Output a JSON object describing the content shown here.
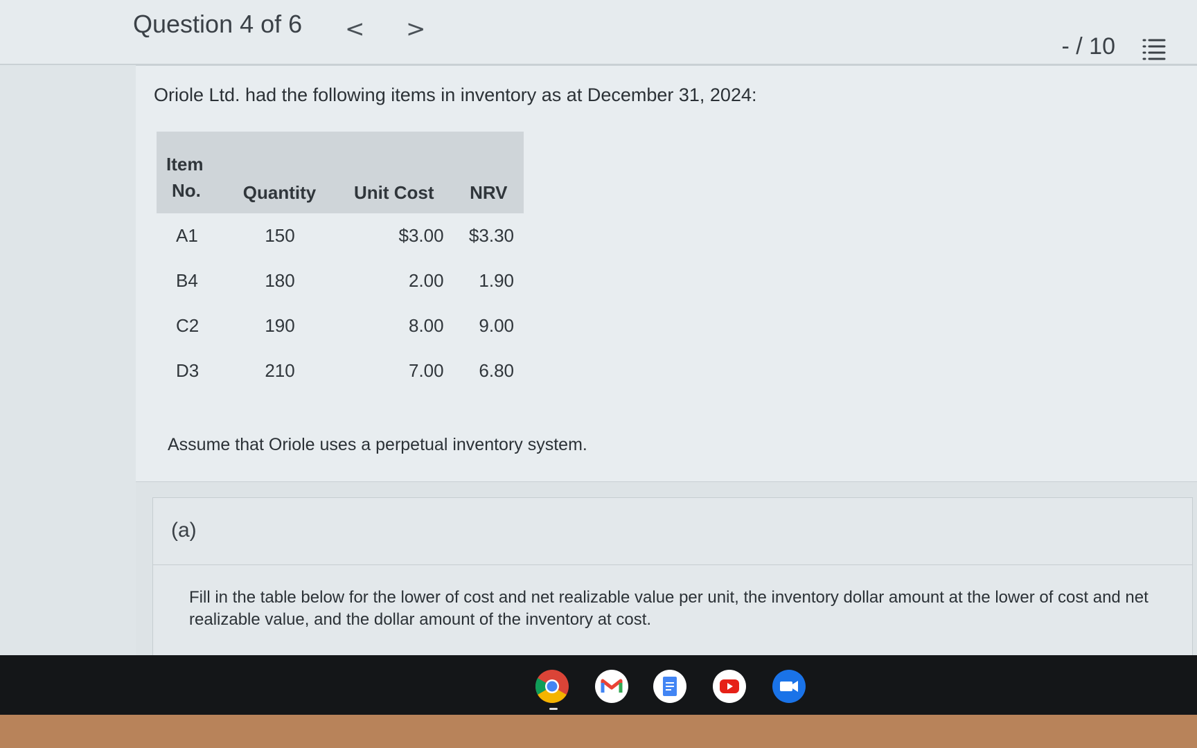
{
  "header": {
    "question_title": "Question 4 of 6",
    "prev_glyph": "<",
    "next_glyph": ">",
    "score": "- / 10"
  },
  "question": {
    "intro": "Oriole Ltd. had the following items in inventory as at December 31, 2024:",
    "table": {
      "headers": {
        "item_line1": "Item",
        "item_line2": "No.",
        "quantity": "Quantity",
        "unit_cost": "Unit Cost",
        "nrv": "NRV"
      },
      "rows": [
        {
          "item": "A1",
          "quantity": "150",
          "unit_cost": "$3.00",
          "nrv": "$3.30"
        },
        {
          "item": "B4",
          "quantity": "180",
          "unit_cost": "2.00",
          "nrv": "1.90"
        },
        {
          "item": "C2",
          "quantity": "190",
          "unit_cost": "8.00",
          "nrv": "9.00"
        },
        {
          "item": "D3",
          "quantity": "210",
          "unit_cost": "7.00",
          "nrv": "6.80"
        }
      ]
    },
    "assumption": "Assume that Oriole uses a perpetual inventory system."
  },
  "part_a": {
    "label": "(a)",
    "instructions": "Fill in the table below for the lower of cost and net realizable value per unit, the inventory dollar amount at the lower of cost and net realizable value, and the dollar amount of the inventory at cost."
  },
  "shelf": {
    "apps": [
      "chrome-icon",
      "gmail-icon",
      "docs-icon",
      "youtube-icon",
      "meet-icon"
    ],
    "colors": {
      "chrome_red": "#db4437",
      "chrome_yellow": "#f4b400",
      "chrome_green": "#0f9d58",
      "chrome_blue": "#4285f4",
      "youtube_red": "#e62117",
      "meet_blue": "#1a73e8"
    }
  }
}
